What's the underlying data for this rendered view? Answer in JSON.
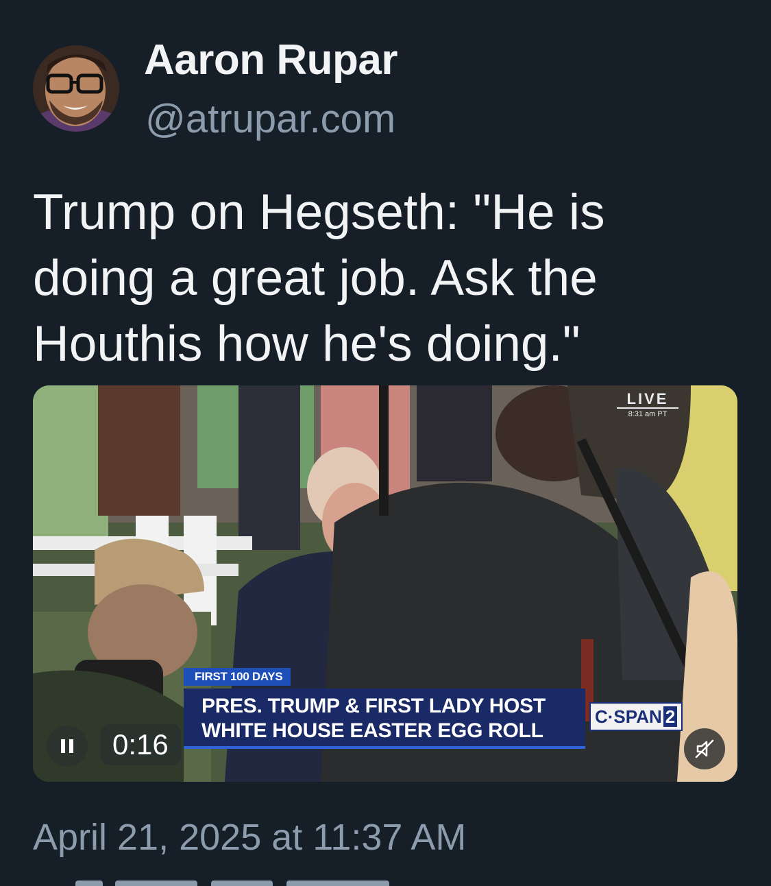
{
  "author": {
    "display_name": "Aaron Rupar",
    "handle": "@atrupar.com"
  },
  "post": {
    "text_lines": [
      "Trump on Hegseth: \"He is",
      "doing a great job. Ask the",
      "Houthis how he's doing.\""
    ],
    "timestamp": "April 21, 2025 at 11:37 AM"
  },
  "video": {
    "elapsed": "0:16",
    "live_label": "LIVE",
    "live_time": "8:31 am PT",
    "chyron_tag": "FIRST 100 DAYS",
    "chyron_lines": [
      "PRES. TRUMP & FIRST LADY HOST",
      "WHITE HOUSE EASTER EGG ROLL"
    ],
    "network_name": "C·SPAN",
    "network_number": "2",
    "controls": {
      "pause_icon": "pause-icon",
      "mute_icon": "muted-speaker-icon"
    }
  },
  "colors": {
    "background": "#161e27",
    "primary_text": "#f1f3f5",
    "secondary_text": "#8c9cad",
    "chyron_blue": "#1a2a66"
  }
}
